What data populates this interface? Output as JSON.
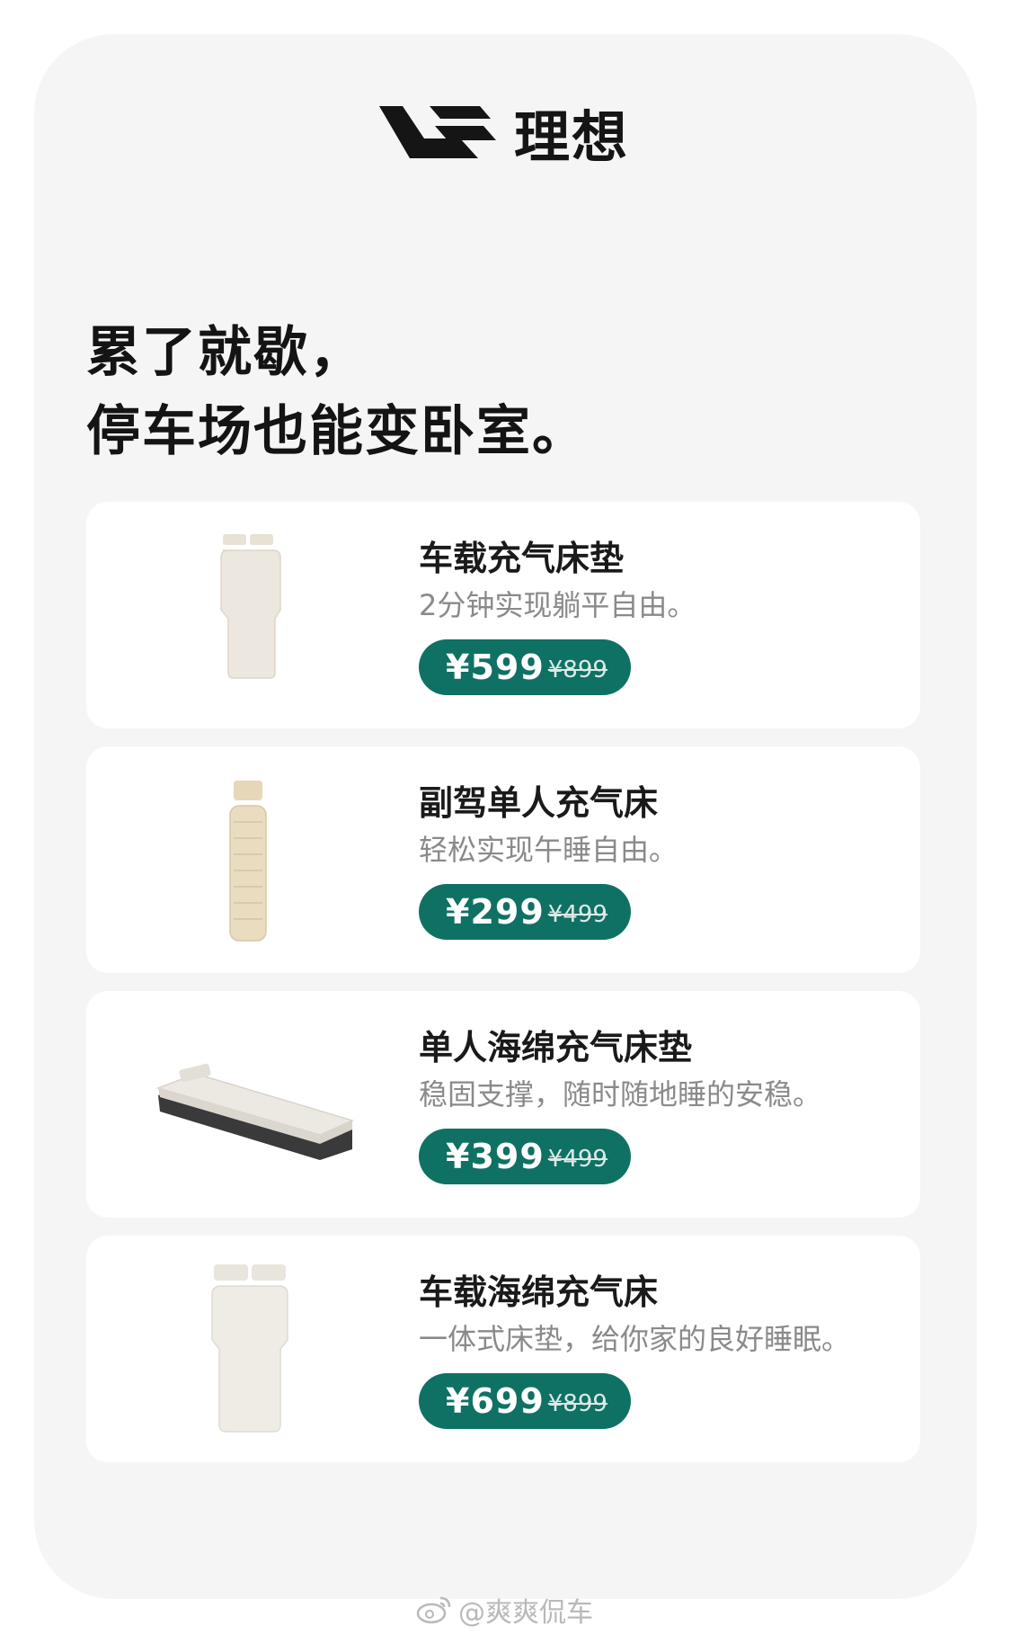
{
  "brand": {
    "name": "理想",
    "logo_icon": "li-auto-logo-icon"
  },
  "headline": {
    "line1": "累了就歇，",
    "line2": "停车场也能变卧室。"
  },
  "colors": {
    "accent": "#0f7163",
    "card_bg": "#ffffff",
    "page_bg": "#f5f5f5"
  },
  "products": [
    {
      "title": "车载充气床垫",
      "desc": "2分钟实现躺平自由。",
      "price": "¥599",
      "original_price": "¥899",
      "image": "air-mattress-image"
    },
    {
      "title": "副驾单人充气床",
      "desc": "轻松实现午睡自由。",
      "price": "¥299",
      "original_price": "¥499",
      "image": "single-air-bed-image"
    },
    {
      "title": "单人海绵充气床垫",
      "desc": "稳固支撑，随时随地睡的安稳。",
      "price": "¥399",
      "original_price": "¥499",
      "image": "sponge-air-mattress-image"
    },
    {
      "title": "车载海绵充气床",
      "desc": "一体式床垫，给你家的良好睡眠。",
      "price": "¥699",
      "original_price": "¥899",
      "image": "sponge-air-bed-image"
    }
  ],
  "watermark": {
    "text": "@爽爽侃车",
    "icon": "weibo-icon"
  }
}
